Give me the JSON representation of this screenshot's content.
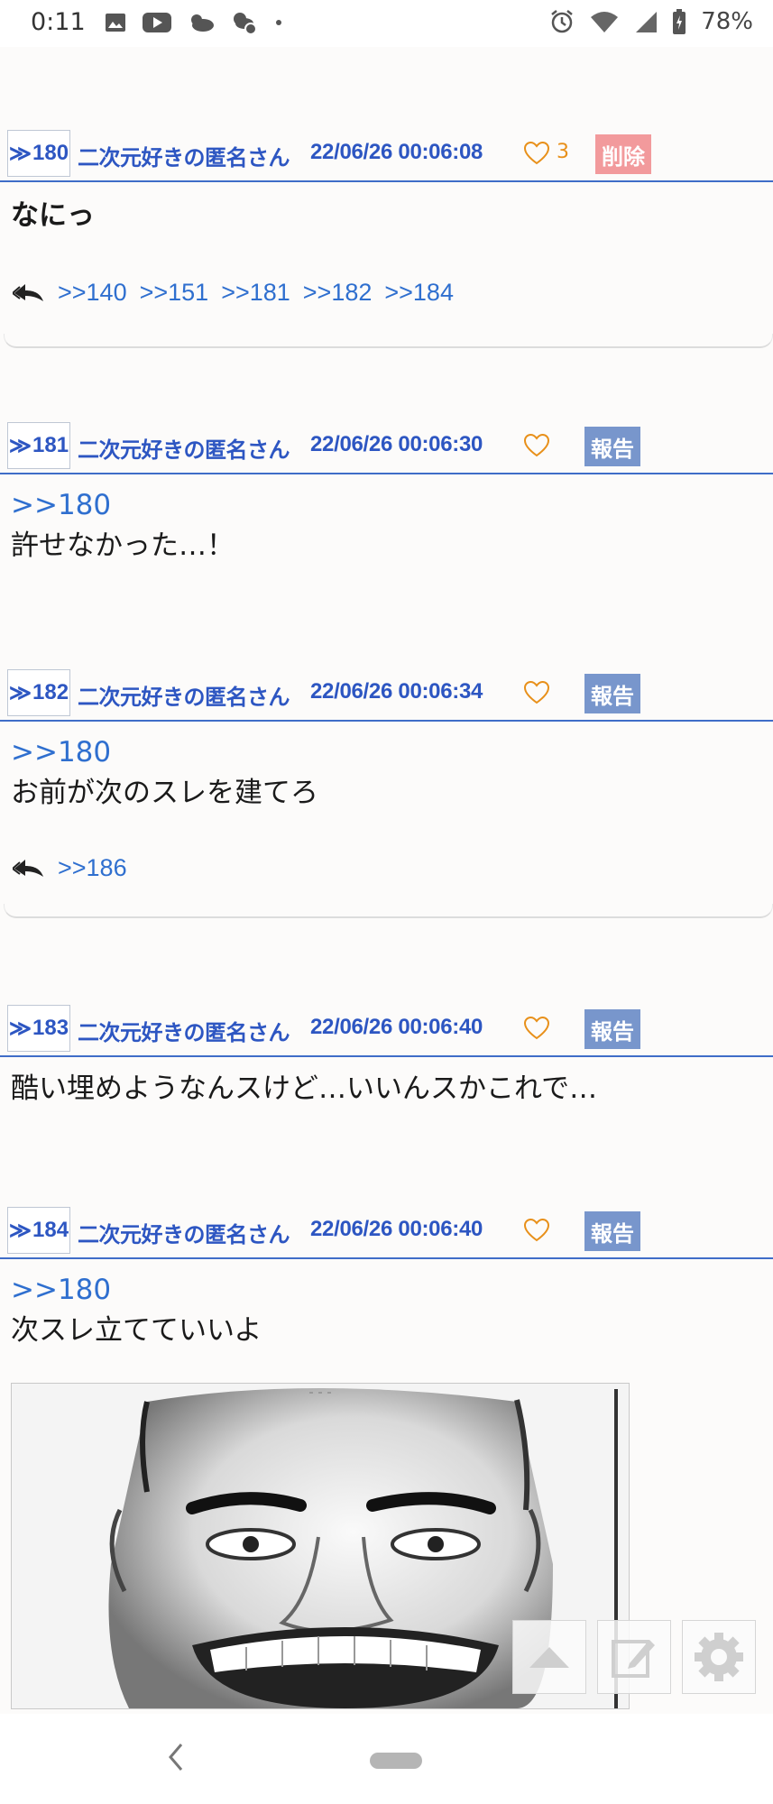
{
  "status_bar": {
    "time": "0:11",
    "battery": "78%",
    "left_icons": [
      "image-icon",
      "youtube-icon",
      "cloud-icon",
      "weather-icon",
      "dot-icon"
    ],
    "right_icons": [
      "alarm-icon",
      "wifi-icon",
      "signal-icon",
      "battery-icon"
    ]
  },
  "colors": {
    "link": "#2f6fcf",
    "header_text": "#2d56c2",
    "rule": "#3f6dc8",
    "delete_badge": "#f29a9c",
    "report_badge": "#7896cc",
    "heart": "#e8901a"
  },
  "posts": [
    {
      "resnum": "180",
      "name": "二次元好きの匿名さん",
      "date": "22/06/26  00:06:08",
      "likes": "3",
      "action": "削除",
      "anchor": "",
      "message": "なにっ",
      "replies": [
        ">>140",
        ">>151",
        ">>181",
        ">>182",
        ">>184"
      ]
    },
    {
      "resnum": "181",
      "name": "二次元好きの匿名さん",
      "date": "22/06/26  00:06:30",
      "likes": "",
      "action": "報告",
      "anchor": ">>180",
      "message": "許せなかった…！",
      "replies": []
    },
    {
      "resnum": "182",
      "name": "二次元好きの匿名さん",
      "date": "22/06/26  00:06:34",
      "likes": "",
      "action": "報告",
      "anchor": ">>180",
      "message": "お前が次のスレを建てろ",
      "replies": [
        ">>186"
      ]
    },
    {
      "resnum": "183",
      "name": "二次元好きの匿名さん",
      "date": "22/06/26  00:06:40",
      "likes": "",
      "action": "報告",
      "anchor": "",
      "message": "酷い埋めようなんスけど…いいんスかこれで…",
      "replies": []
    },
    {
      "resnum": "184",
      "name": "二次元好きの匿名さん",
      "date": "22/06/26  00:06:40",
      "likes": "",
      "action": "報告",
      "anchor": ">>180",
      "message": "次スレ立てていいよ",
      "replies": []
    }
  ],
  "floating_buttons": [
    "scroll-top-icon",
    "compose-icon",
    "settings-gear-icon"
  ],
  "nav": {
    "icons": [
      "back-icon",
      "home-pill-icon"
    ]
  }
}
